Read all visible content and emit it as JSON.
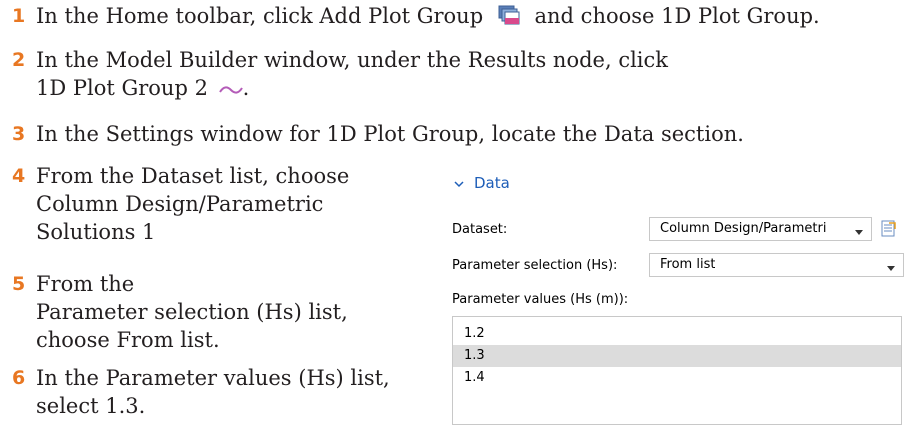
{
  "steps": [
    {
      "num": "1",
      "text_before": "In the Home toolbar, click Add Plot Group",
      "text_after": "and choose 1D Plot Group.",
      "icon": "add-plot-group-icon"
    },
    {
      "num": "2",
      "line1": "In the Model Builder window, under the Results node, click",
      "line2": "1D Plot Group 2",
      "icon": "line-plot-icon"
    },
    {
      "num": "3",
      "text": "In the Settings window for 1D Plot Group, locate the Data section."
    },
    {
      "num": "4",
      "line1": "From the Dataset list, choose",
      "line2": "Column Design/Parametric",
      "line3": "Solutions 1"
    },
    {
      "num": "5",
      "line1": "From the",
      "line2": "Parameter selection (Hs) list,",
      "line3": "choose From list."
    },
    {
      "num": "6",
      "line1": "In the Parameter values (Hs) list,",
      "line2": "select 1.3."
    }
  ],
  "panel": {
    "section_title": "Data",
    "dataset_label": "Dataset:",
    "dataset_value": "Column Design/Parametri",
    "param_sel_label": "Parameter selection (Hs):",
    "param_sel_value": "From list",
    "param_values_label": "Parameter values (Hs (m)):",
    "param_values": [
      "1.2",
      "1.3",
      "1.4"
    ],
    "selected_value": "1.3"
  },
  "colors": {
    "step_number": "#e87722",
    "section_title": "#1e5eb8"
  }
}
